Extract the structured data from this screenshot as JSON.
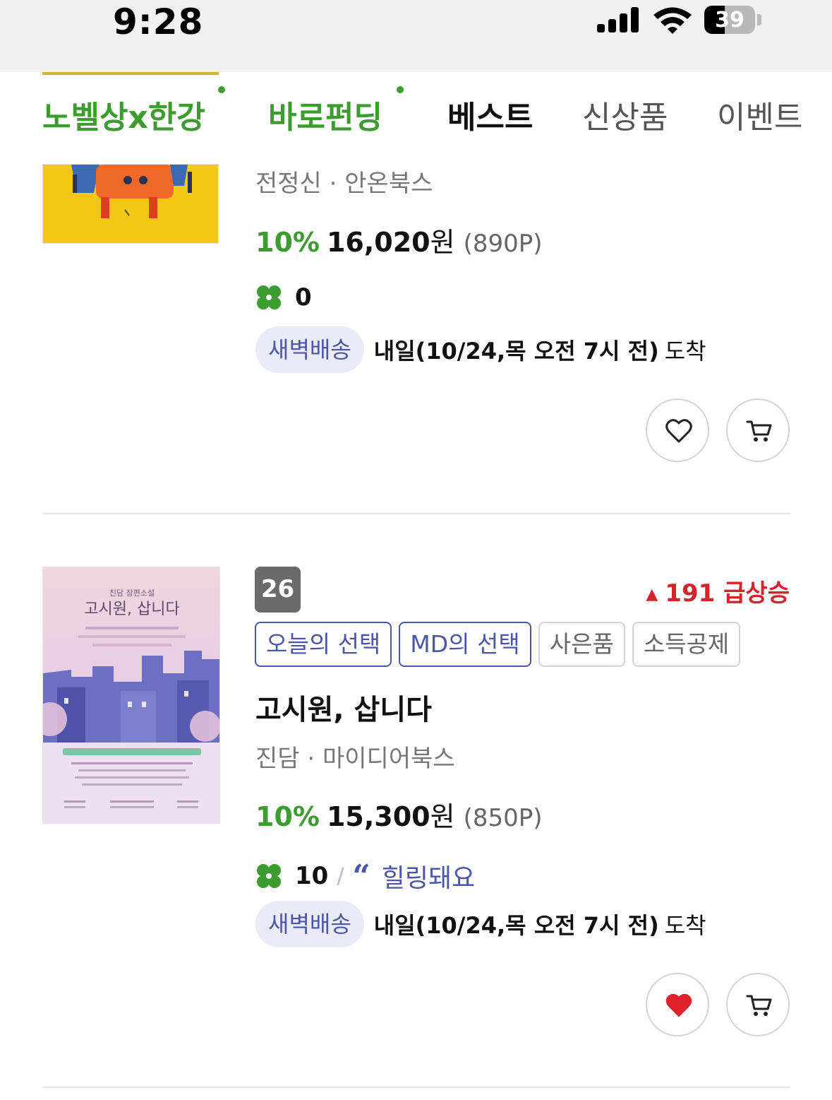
{
  "status_bar": {
    "time": "9:28",
    "battery": "39"
  },
  "nav": {
    "tabs": [
      {
        "label": "노벨상x한강"
      },
      {
        "label": "바로펀딩"
      },
      {
        "label": "베스트"
      },
      {
        "label": "신상품"
      },
      {
        "label": "이벤트"
      }
    ]
  },
  "products": [
    {
      "author_publisher": "전정신 · 안온북스",
      "discount": "10%",
      "price": "16,020",
      "currency": "원",
      "points": "(890P)",
      "clover_count": "0",
      "delivery_badge": "새벽배송",
      "delivery_date": "내일(10/24,목 오전 7시 전)",
      "delivery_suffix": "도착"
    },
    {
      "rank": "26",
      "rank_change": "191 급상승",
      "tags": [
        "오늘의 선택",
        "MD의 선택",
        "사은품",
        "소득공제"
      ],
      "title": "고시원, 삽니다",
      "author_publisher": "진담 · 마이디어북스",
      "discount": "10%",
      "price": "15,300",
      "currency": "원",
      "points": "(850P)",
      "clover_count": "10",
      "review_keyword": "힐링돼요",
      "delivery_badge": "새벽배송",
      "delivery_date": "내일(10/24,목 오전 7시 전)",
      "delivery_suffix": "도착",
      "wishlisted": true
    }
  ],
  "cover2_text": {
    "kicker": "진담 장편소설",
    "title": "고시원, 삽니다"
  },
  "colors": {
    "brand_green": "#3d9c2f",
    "accent_navy": "#4a57a8",
    "rank_up_red": "#d8232a",
    "heart_red": "#e0202a"
  }
}
